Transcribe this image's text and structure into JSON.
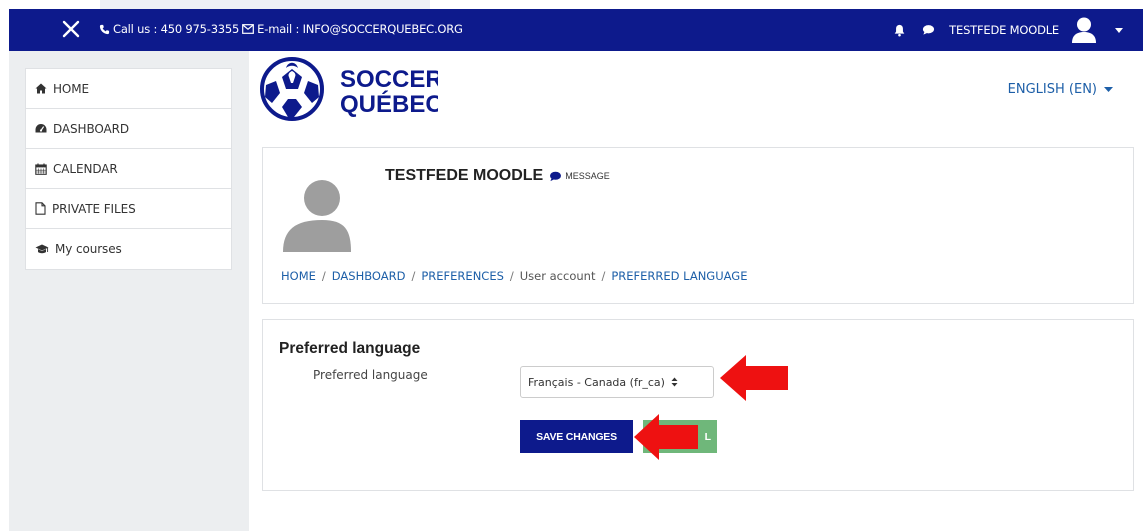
{
  "navbar": {
    "contact_text": "Call us : 450 975-3355",
    "email_text": "E-mail : INFO@SOCCERQUEBEC.ORG",
    "user_name": "TESTFEDE MOODLE"
  },
  "colors": {
    "brand_navy": "#0d1a8c",
    "link_blue": "#1d5fa8",
    "cancel_green": "#6fb77a",
    "annotation_red": "#ee1111"
  },
  "sidebar": {
    "items": [
      {
        "label": "HOME",
        "icon": "home-icon"
      },
      {
        "label": "DASHBOARD",
        "icon": "tachometer-icon"
      },
      {
        "label": "CALENDAR",
        "icon": "calendar-icon"
      },
      {
        "label": "PRIVATE FILES",
        "icon": "file-icon"
      },
      {
        "label": "My courses",
        "icon": "graduation-cap-icon"
      }
    ]
  },
  "logo": {
    "line1": "SOCCER",
    "line2": "QUÉBEC"
  },
  "language_menu": {
    "label": "ENGLISH (EN)"
  },
  "profile": {
    "name": "TESTFEDE MOODLE",
    "message_label": "MESSAGE"
  },
  "breadcrumb": {
    "items": [
      "HOME",
      "DASHBOARD",
      "PREFERENCES",
      "User account",
      "PREFERRED LANGUAGE"
    ],
    "separator": "/"
  },
  "preferences": {
    "title": "Preferred language",
    "field_label": "Preferred language",
    "selected_value": "Français - Canada (fr_ca)",
    "save_label": "SAVE CHANGES",
    "cancel_label": "L"
  }
}
